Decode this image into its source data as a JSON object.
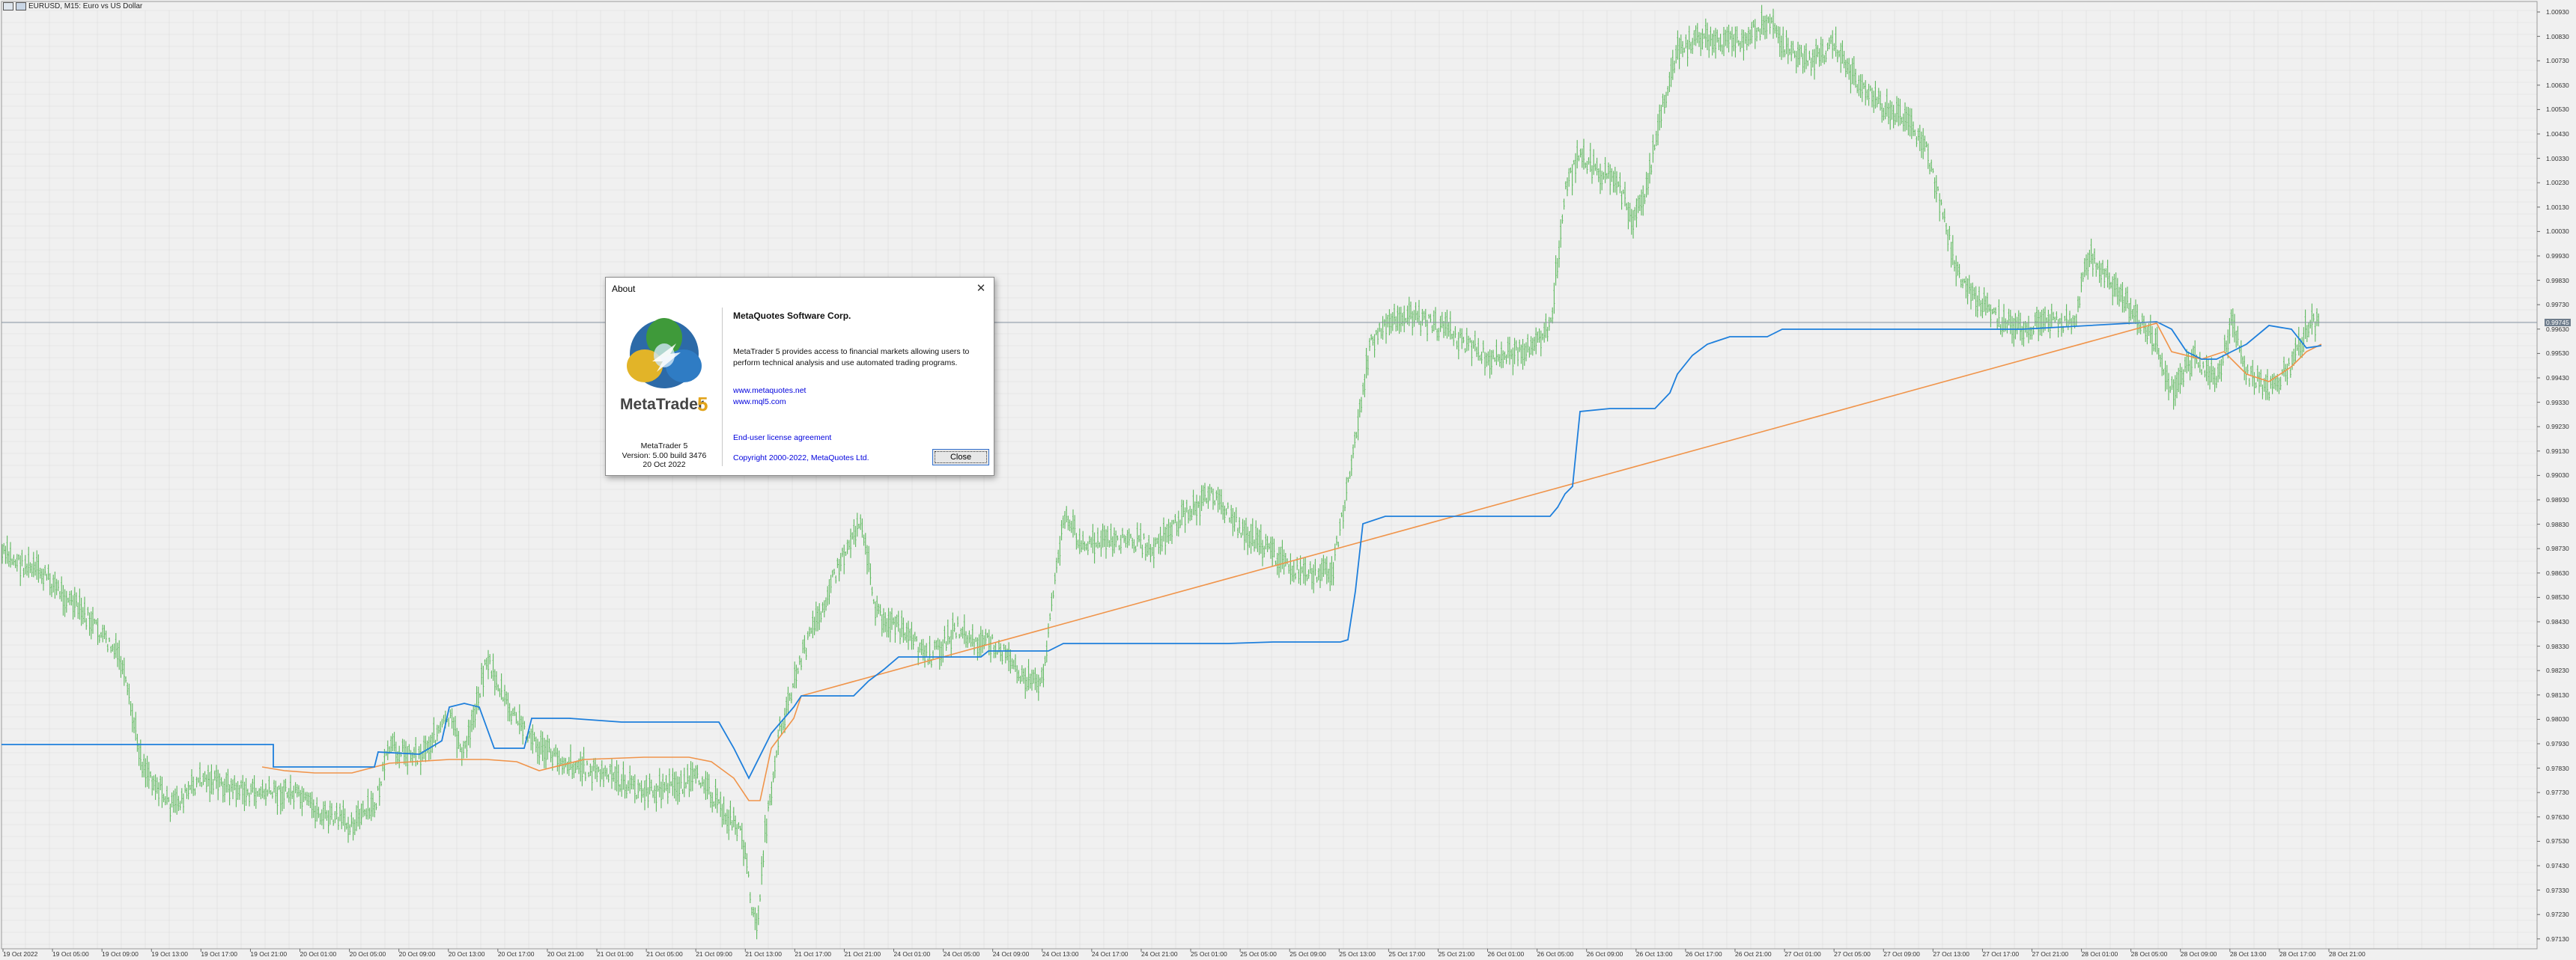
{
  "window": {
    "title": "EURUSD, M15:  Euro vs US Dollar"
  },
  "price_axis": {
    "labels": [
      "1.00930",
      "1.00830",
      "1.00730",
      "1.00630",
      "1.00530",
      "1.00430",
      "1.00330",
      "1.00230",
      "1.00130",
      "1.00030",
      "0.99930",
      "0.99830",
      "0.99730",
      "0.99630",
      "0.99530",
      "0.99430",
      "0.99330",
      "0.99230",
      "0.99130",
      "0.99030",
      "0.98930",
      "0.98830",
      "0.98730",
      "0.98630",
      "0.98530",
      "0.98430",
      "0.98330",
      "0.98230",
      "0.98130",
      "0.98030",
      "0.97930",
      "0.97830",
      "0.97730",
      "0.97630",
      "0.97530",
      "0.97430",
      "0.97330",
      "0.97230",
      "0.97130"
    ],
    "current_price": "0.99745"
  },
  "time_axis": {
    "labels": [
      "19 Oct 2022",
      "19 Oct 05:00",
      "19 Oct 09:00",
      "19 Oct 13:00",
      "19 Oct 17:00",
      "19 Oct 21:00",
      "20 Oct 01:00",
      "20 Oct 05:00",
      "20 Oct 09:00",
      "20 Oct 13:00",
      "20 Oct 17:00",
      "20 Oct 21:00",
      "21 Oct 01:00",
      "21 Oct 05:00",
      "21 Oct 09:00",
      "21 Oct 13:00",
      "21 Oct 17:00",
      "21 Oct 21:00",
      "24 Oct 01:00",
      "24 Oct 05:00",
      "24 Oct 09:00",
      "24 Oct 13:00",
      "24 Oct 17:00",
      "24 Oct 21:00",
      "25 Oct 01:00",
      "25 Oct 05:00",
      "25 Oct 09:00",
      "25 Oct 13:00",
      "25 Oct 17:00",
      "25 Oct 21:00",
      "26 Oct 01:00",
      "26 Oct 05:00",
      "26 Oct 09:00",
      "26 Oct 13:00",
      "26 Oct 17:00",
      "26 Oct 21:00",
      "27 Oct 01:00",
      "27 Oct 05:00",
      "27 Oct 09:00",
      "27 Oct 13:00",
      "27 Oct 17:00",
      "27 Oct 21:00",
      "28 Oct 01:00",
      "28 Oct 05:00",
      "28 Oct 09:00",
      "28 Oct 13:00",
      "28 Oct 17:00",
      "28 Oct 21:00"
    ]
  },
  "colors": {
    "background": "#f0f0f0",
    "grid": "#dcdcdc",
    "bars": "#5cb85c",
    "indicator_blue": "#1e7fdc",
    "indicator_orange": "#f0944a",
    "current_line": "#8a97a5"
  },
  "dialog": {
    "title": "About",
    "close_icon": "close-icon",
    "logo_text": "MetaTrader",
    "logo_number": "5",
    "product_name": "MetaTrader 5",
    "version": "Version: 5.00 build 3476",
    "date": "20 Oct 2022",
    "company": "MetaQuotes Software Corp.",
    "description": "MetaTrader 5 provides access to financial markets allowing users to perform technical analysis and use automated trading programs.",
    "link1": "www.metaquotes.net",
    "link2": "www.mql5.com",
    "license": "End-user license agreement",
    "copyright": "Copyright 2000-2022, MetaQuotes Ltd.",
    "close_button": "Close"
  }
}
